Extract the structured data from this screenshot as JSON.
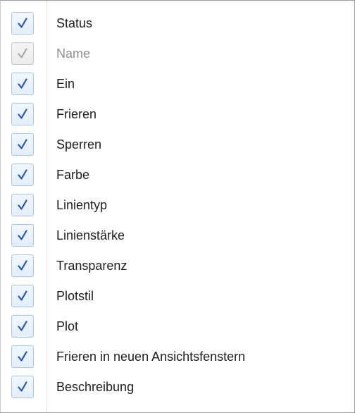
{
  "menu": {
    "items": [
      {
        "label": "Status",
        "checked": true,
        "enabled": true
      },
      {
        "label": "Name",
        "checked": true,
        "enabled": false
      },
      {
        "label": "Ein",
        "checked": true,
        "enabled": true
      },
      {
        "label": "Frieren",
        "checked": true,
        "enabled": true
      },
      {
        "label": "Sperren",
        "checked": true,
        "enabled": true
      },
      {
        "label": "Farbe",
        "checked": true,
        "enabled": true
      },
      {
        "label": "Linientyp",
        "checked": true,
        "enabled": true
      },
      {
        "label": "Linienstärke",
        "checked": true,
        "enabled": true
      },
      {
        "label": "Transparenz",
        "checked": true,
        "enabled": true
      },
      {
        "label": "Plotstil",
        "checked": true,
        "enabled": true
      },
      {
        "label": "Plot",
        "checked": true,
        "enabled": true
      },
      {
        "label": "Frieren in neuen Ansichtsfenstern",
        "checked": true,
        "enabled": true
      },
      {
        "label": "Beschreibung",
        "checked": true,
        "enabled": true
      }
    ]
  },
  "colors": {
    "check_enabled": "#1f55c8",
    "check_disabled": "#a8a8a8",
    "text_enabled": "#1e1e1e",
    "text_disabled": "#8d8d8d"
  }
}
